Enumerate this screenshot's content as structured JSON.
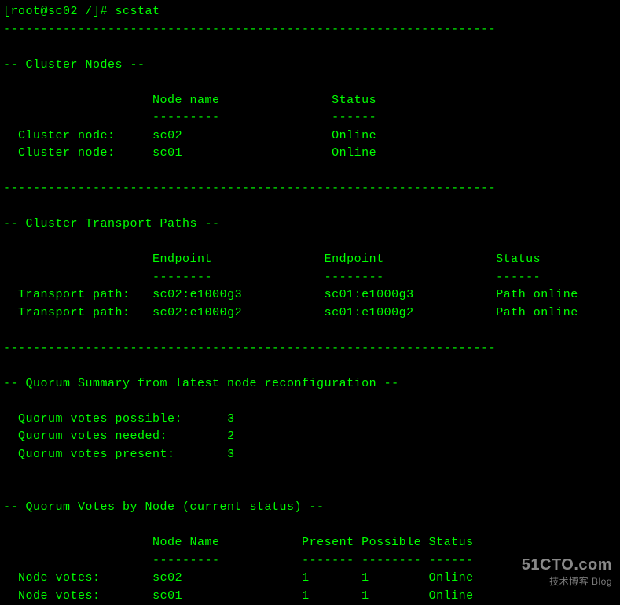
{
  "prompt": "[root@sc02 /]# scstat",
  "divider": "------------------------------------------------------------------",
  "sections": {
    "cluster_nodes": {
      "title": "-- Cluster Nodes --",
      "headers": {
        "col1": "Node name",
        "col2": "Status"
      },
      "underlines": {
        "col1": "---------",
        "col2": "------"
      },
      "rows": [
        {
          "label": "Cluster node:",
          "name": "sc02",
          "status": "Online"
        },
        {
          "label": "Cluster node:",
          "name": "sc01",
          "status": "Online"
        }
      ]
    },
    "transport_paths": {
      "title": "-- Cluster Transport Paths --",
      "headers": {
        "col1": "Endpoint",
        "col2": "Endpoint",
        "col3": "Status"
      },
      "underlines": {
        "col1": "--------",
        "col2": "--------",
        "col3": "------"
      },
      "rows": [
        {
          "label": "Transport path:",
          "ep1": "sc02:e1000g3",
          "ep2": "sc01:e1000g3",
          "status": "Path online"
        },
        {
          "label": "Transport path:",
          "ep1": "sc02:e1000g2",
          "ep2": "sc01:e1000g2",
          "status": "Path online"
        }
      ]
    },
    "quorum_summary": {
      "title": "-- Quorum Summary from latest node reconfiguration --",
      "rows": [
        {
          "label": "Quorum votes possible:",
          "value": "3"
        },
        {
          "label": "Quorum votes needed:",
          "value": "2"
        },
        {
          "label": "Quorum votes present:",
          "value": "3"
        }
      ]
    },
    "quorum_votes": {
      "title": "-- Quorum Votes by Node (current status) --",
      "headers": {
        "col1": "Node Name",
        "col2": "Present",
        "col3": "Possible",
        "col4": "Status"
      },
      "underlines": {
        "col1": "---------",
        "col2": "-------",
        "col3": "--------",
        "col4": "------"
      },
      "rows": [
        {
          "label": "Node votes:",
          "name": "sc02",
          "present": "1",
          "possible": "1",
          "status": "Online"
        },
        {
          "label": "Node votes:",
          "name": "sc01",
          "present": "1",
          "possible": "1",
          "status": "Online"
        }
      ]
    }
  },
  "watermark": {
    "domain": "51CTO.com",
    "tagline": "技术博客",
    "blog": "Blog"
  }
}
